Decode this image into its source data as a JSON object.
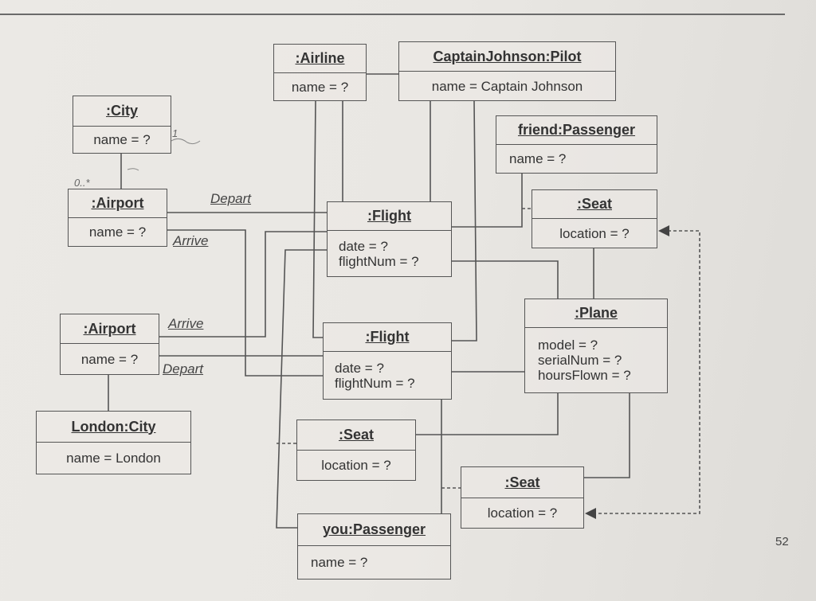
{
  "objects": {
    "city": {
      "title": ":City",
      "attrs": [
        "name = ?"
      ]
    },
    "airport1": {
      "title": ":Airport",
      "attrs": [
        "name = ?"
      ]
    },
    "airline": {
      "title": ":Airline",
      "attrs": [
        "name = ?"
      ]
    },
    "pilot": {
      "title": "CaptainJohnson:Pilot",
      "attrs": [
        "name = Captain Johnson"
      ]
    },
    "friend": {
      "title": "friend:Passenger",
      "attrs": [
        "name = ?"
      ]
    },
    "seat1": {
      "title": ":Seat",
      "attrs": [
        "location = ?"
      ]
    },
    "flight1": {
      "title": ":Flight",
      "attrs": [
        "date = ?",
        "flightNum = ?"
      ]
    },
    "plane": {
      "title": ":Plane",
      "attrs": [
        "model = ?",
        "serialNum = ?",
        "hoursFlown = ?"
      ]
    },
    "airport2": {
      "title": ":Airport",
      "attrs": [
        "name = ?"
      ]
    },
    "flight2": {
      "title": ":Flight",
      "attrs": [
        "date = ?",
        "flightNum = ?"
      ]
    },
    "london": {
      "title": "London:City",
      "attrs": [
        "name = London"
      ]
    },
    "seat2": {
      "title": ":Seat",
      "attrs": [
        "location = ?"
      ]
    },
    "seat3": {
      "title": ":Seat",
      "attrs": [
        "location = ?"
      ]
    },
    "you": {
      "title": "you:Passenger",
      "attrs": [
        "name = ?"
      ]
    }
  },
  "links": {
    "depart1": "Depart",
    "arrive1": "Arrive",
    "arrive2": "Arrive",
    "depart2": "Depart"
  },
  "annotations": {
    "multiplicity": "0..*",
    "one": "1"
  },
  "page_number": "52",
  "colors": {
    "line": "#555555",
    "paper": "#e9e7e3"
  }
}
